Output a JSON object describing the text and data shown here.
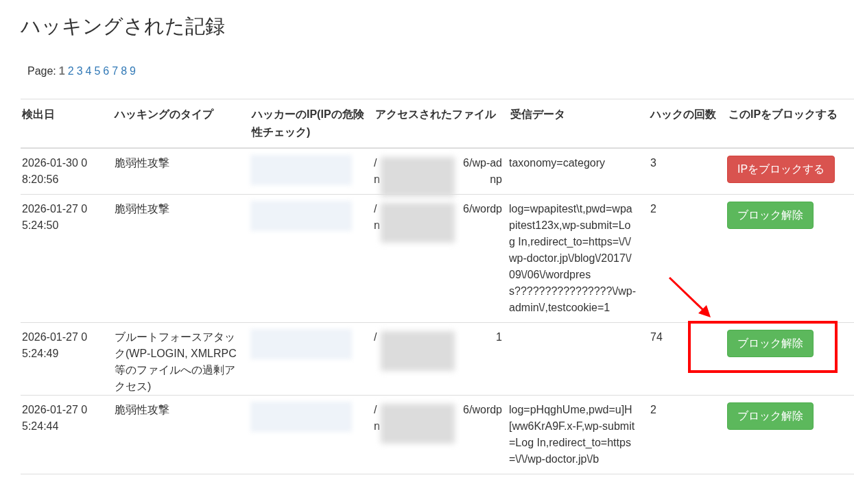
{
  "title": "ハッキングされた記録",
  "pagination": {
    "label": "Page:",
    "pages": [
      {
        "label": "1",
        "selected": true
      },
      {
        "label": "2",
        "selected": false
      },
      {
        "label": "3",
        "selected": false
      },
      {
        "label": "4",
        "selected": false
      },
      {
        "label": "5",
        "selected": false
      },
      {
        "label": "6",
        "selected": false
      },
      {
        "label": "7",
        "selected": false
      },
      {
        "label": "8",
        "selected": false
      },
      {
        "label": "9",
        "selected": false
      }
    ]
  },
  "table": {
    "columns": [
      "検出日",
      "ハッキングのタイプ",
      "ハッカーのIP(IPの危険性チェック)",
      "アクセスされたファイル",
      "受信データ",
      "ハックの回数",
      "このIPをブロックする"
    ],
    "rows": [
      {
        "date": "2026-01-30 08:20:56",
        "type": "脆弱性攻撃",
        "file_lines": [
          {
            "start": "/",
            "end": "6/wp-ad"
          },
          {
            "start": "n",
            "end": "np"
          }
        ],
        "data": "taxonomy=category",
        "count": "3",
        "action": {
          "kind": "block",
          "label": "IPをブロックする"
        },
        "highlighted": false
      },
      {
        "date": "2026-01-27 05:24:50",
        "type": "脆弱性攻撃",
        "file_lines": [
          {
            "start": "/",
            "end": "6/wordp"
          },
          {
            "start": "n"
          }
        ],
        "data": "log=wpapitest\\t,pwd=wpapitest123x,wp-submit=Log In,redirect_to=https=\\/\\/wp-doctor.jp\\/blog\\/2017\\/09\\/06\\/wordpress????????????????\\/wp-admin\\/,testcookie=1",
        "count": "2",
        "action": {
          "kind": "unblock",
          "label": "ブロック解除"
        },
        "highlighted": false
      },
      {
        "date": "2026-01-27 05:24:49",
        "type": "ブルートフォースアタック(WP-LOGIN, XMLRPC等のファイルへの過剰アクセス)",
        "file_lines": [
          {
            "start": "/",
            "end": "1"
          }
        ],
        "count": "74",
        "action": {
          "kind": "unblock",
          "label": "ブロック解除"
        },
        "highlighted": true
      },
      {
        "date": "2026-01-27 05:24:44",
        "type": "脆弱性攻撃",
        "file_lines": [
          {
            "start": "/",
            "end": "6/wordp"
          },
          {
            "start": "n"
          }
        ],
        "data": "log=pHqghUme,pwd=u]H[ww6KrA9F.x-F,wp-submit=Log In,redirect_to=https=\\/\\/wp-doctor.jp\\/b",
        "count": "2",
        "action": {
          "kind": "unblock",
          "label": "ブロック解除"
        },
        "highlighted": false
      }
    ]
  }
}
